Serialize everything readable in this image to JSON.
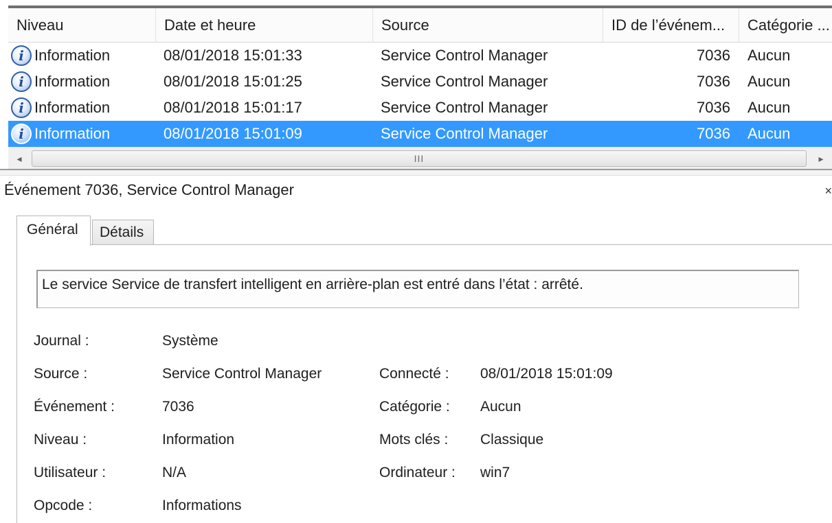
{
  "event_list": {
    "columns": {
      "level": "Niveau",
      "date": "Date et heure",
      "source": "Source",
      "event_id": "ID de l’événem...",
      "category": "Catégorie ..."
    },
    "rows": [
      {
        "level": "Information",
        "date": "08/01/2018 15:01:33",
        "source": "Service Control Manager",
        "event_id": "7036",
        "category": "Aucun",
        "icon": "info-icon",
        "selected": false
      },
      {
        "level": "Information",
        "date": "08/01/2018 15:01:25",
        "source": "Service Control Manager",
        "event_id": "7036",
        "category": "Aucun",
        "icon": "info-icon",
        "selected": false
      },
      {
        "level": "Information",
        "date": "08/01/2018 15:01:17",
        "source": "Service Control Manager",
        "event_id": "7036",
        "category": "Aucun",
        "icon": "info-icon",
        "selected": false
      },
      {
        "level": "Information",
        "date": "08/01/2018 15:01:09",
        "source": "Service Control Manager",
        "event_id": "7036",
        "category": "Aucun",
        "icon": "info-icon",
        "selected": true
      }
    ],
    "icon_glyph": "i",
    "scrollbar": {
      "left_arrow": "◂",
      "right_arrow": "▸",
      "grip": "III"
    },
    "selection_color": "#3399ff"
  },
  "details": {
    "title": "Événement 7036, Service Control Manager",
    "close_glyph": "×",
    "tabs": {
      "general": "Général",
      "details": "Détails",
      "active": "general"
    },
    "message": "Le service Service de transfert intelligent en arrière-plan est entré dans l’état : arrêté.",
    "fields": {
      "journal_label": "Journal :",
      "journal_value": "Système",
      "source_label": "Source :",
      "source_value": "Service Control Manager",
      "event_label": "Événement :",
      "event_value": "7036",
      "level_label": "Niveau :",
      "level_value": "Information",
      "user_label": "Utilisateur :",
      "user_value": "N/A",
      "opcode_label": "Opcode :",
      "opcode_value": "Informations",
      "logged_label": "Connecté :",
      "logged_value": "08/01/2018 15:01:09",
      "category_label": "Catégorie :",
      "category_value": "Aucun",
      "keywords_label": "Mots clés :",
      "keywords_value": "Classique",
      "computer_label": "Ordinateur :",
      "computer_value": "win7"
    }
  }
}
